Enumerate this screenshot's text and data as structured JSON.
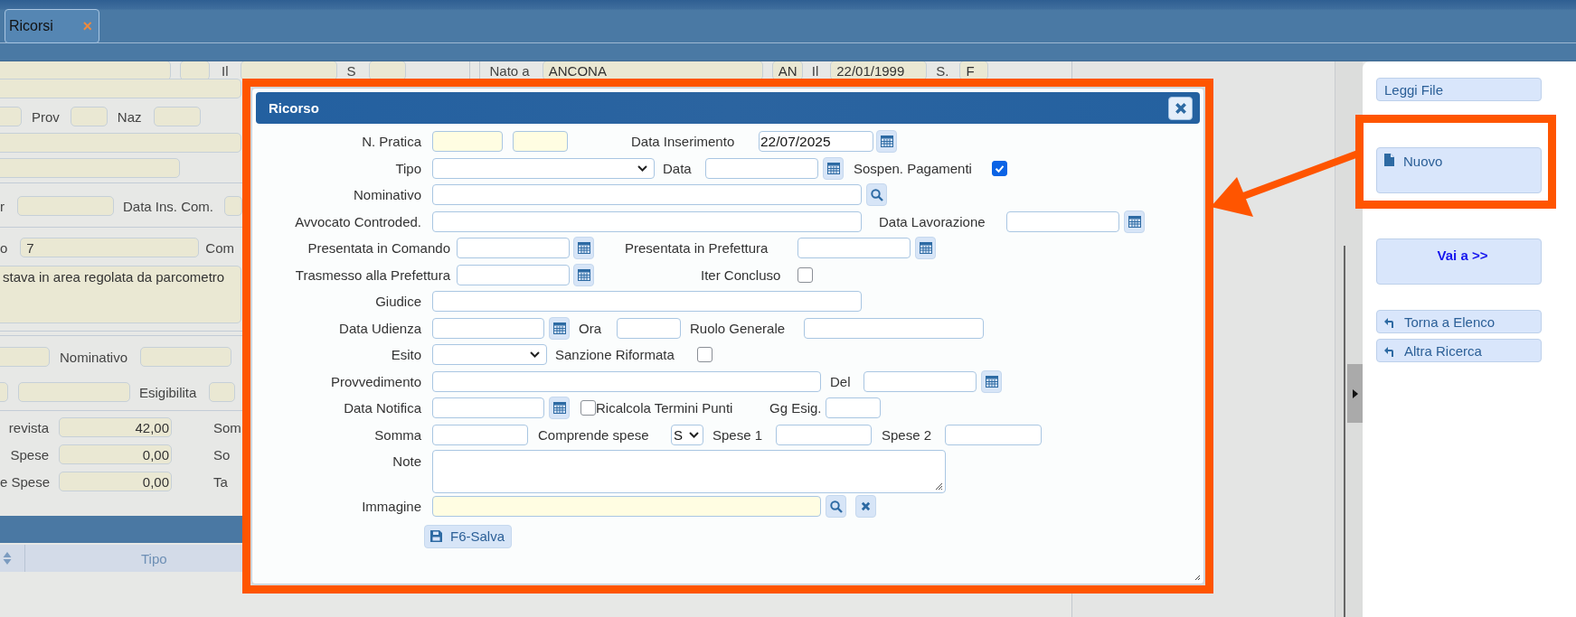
{
  "tabs": [
    {
      "label": "Ricorsi",
      "selected": true,
      "close": "×"
    }
  ],
  "background_form": {
    "row_1": {
      "label_1": "Il",
      "label_2": "S",
      "nato_a": "Nato a",
      "birthplace": "ANCONA",
      "province": "AN",
      "label_3": "Il",
      "birth_date": "22/01/1999",
      "label_4": "S.",
      "sex": "F"
    },
    "prov": "Prov",
    "naz": "Naz",
    "label_r": "r",
    "data_ins_com": "Data Ins. Com.",
    "label_o": "o",
    "field_7": "7",
    "comm": "Com",
    "description": "stava in area regolata da parcometro",
    "nominativo": "Nominativo",
    "esigibilita": "Esigibilita",
    "amounts": [
      {
        "label": "revista",
        "value": "42,00",
        "label_2": "Som"
      },
      {
        "label": "Spese",
        "value": "0,00",
        "label_2": "So"
      },
      {
        "label": "e Spese",
        "value": "0,00",
        "label_2": "Ta"
      }
    ]
  },
  "table": {
    "columns": [
      {
        "label": "Tipo"
      }
    ]
  },
  "dialog": {
    "title": "Ricorso",
    "n_pratica": {
      "label": "N. Pratica"
    },
    "data_inserimento": {
      "label": "Data Inserimento",
      "value": "22/07/2025"
    },
    "tipo": {
      "label": "Tipo"
    },
    "data": {
      "label": "Data"
    },
    "sospen_pagamenti": {
      "label": "Sospen. Pagamenti",
      "checked": true
    },
    "nominativo": {
      "label": "Nominativo"
    },
    "avvocato_controded": {
      "label": "Avvocato Controded."
    },
    "data_lavorazione": {
      "label": "Data Lavorazione"
    },
    "presentata_in_comando": {
      "label": "Presentata in Comando"
    },
    "presentata_in_prefettura": {
      "label": "Presentata in Prefettura"
    },
    "trasmesso_alla_prefettura": {
      "label": "Trasmesso alla Prefettura"
    },
    "iter_concluso": {
      "label": "Iter Concluso",
      "checked": false
    },
    "giudice": {
      "label": "Giudice"
    },
    "data_udienza": {
      "label": "Data Udienza"
    },
    "ora": {
      "label": "Ora"
    },
    "ruolo_generale": {
      "label": "Ruolo Generale"
    },
    "esito": {
      "label": "Esito"
    },
    "sanzione_riformata": {
      "label": "Sanzione Riformata",
      "checked": false
    },
    "provvedimento": {
      "label": "Provvedimento"
    },
    "del": {
      "label": "Del"
    },
    "data_notifica": {
      "label": "Data Notifica"
    },
    "ricalcola_termini_punti": {
      "label": "Ricalcola Termini Punti",
      "checked": false
    },
    "gg_esig": {
      "label": "Gg Esig."
    },
    "somma": {
      "label": "Somma"
    },
    "comprende_spese": {
      "label": "Comprende spese",
      "value": "S"
    },
    "spese_1": {
      "label": "Spese 1"
    },
    "spese_2": {
      "label": "Spese 2"
    },
    "note": {
      "label": "Note"
    },
    "immagine": {
      "label": "Immagine"
    },
    "save_button": "F6-Salva"
  },
  "side_panel": {
    "buttons": [
      {
        "label": "Leggi File",
        "kind": "plain"
      },
      {
        "label": "Nuovo",
        "kind": "document"
      },
      {
        "label": "Vai a >>",
        "kind": "goto"
      },
      {
        "label": "Torna a Elenco",
        "kind": "back"
      },
      {
        "label": "Altra Ricerca",
        "kind": "back"
      }
    ]
  }
}
